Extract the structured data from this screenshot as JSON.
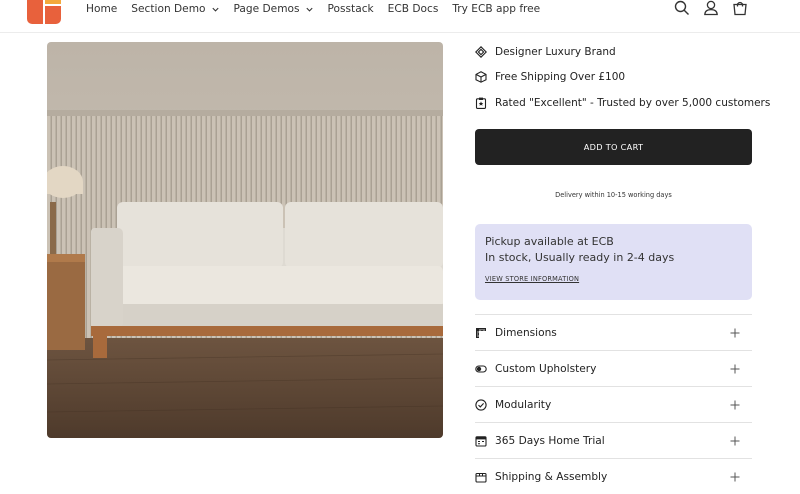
{
  "header": {
    "nav": [
      {
        "label": "Home",
        "dropdown": false
      },
      {
        "label": "Section Demo",
        "dropdown": true
      },
      {
        "label": "Page Demos",
        "dropdown": true
      },
      {
        "label": "Posstack",
        "dropdown": false
      },
      {
        "label": "ECB Docs",
        "dropdown": false
      },
      {
        "label": "Try ECB app free",
        "dropdown": false
      }
    ],
    "icons": [
      "search-icon",
      "account-icon",
      "cart-icon"
    ]
  },
  "product": {
    "image": "sofa-photo",
    "badges": [
      {
        "icon": "diamond-icon",
        "text": "Designer Luxury Brand"
      },
      {
        "icon": "box-icon",
        "text": "Free Shipping Over £100"
      },
      {
        "icon": "clipboard-star-icon",
        "text": "Rated \"Excellent\" - Trusted by over 5,000 customers"
      }
    ],
    "add_to_cart": "ADD TO CART",
    "delivery_note": "Delivery within 10-15 working days",
    "pickup": {
      "line1": "Pickup available at ECB",
      "line2": "In stock, Usually ready in 2-4 days",
      "link": "VIEW STORE INFORMATION"
    },
    "accordions": [
      {
        "icon": "ruler-icon",
        "label": "Dimensions"
      },
      {
        "icon": "toggle-icon",
        "label": "Custom Upholstery"
      },
      {
        "icon": "check-circle-icon",
        "label": "Modularity"
      },
      {
        "icon": "calendar-icon",
        "label": "365 Days Home Trial"
      },
      {
        "icon": "package-icon",
        "label": "Shipping & Assembly"
      }
    ]
  },
  "colors": {
    "brand_orange": "#e8613c",
    "brand_yellow": "#f3a93c",
    "button_dark": "#222222",
    "pickup_bg": "#e0e0f5"
  }
}
